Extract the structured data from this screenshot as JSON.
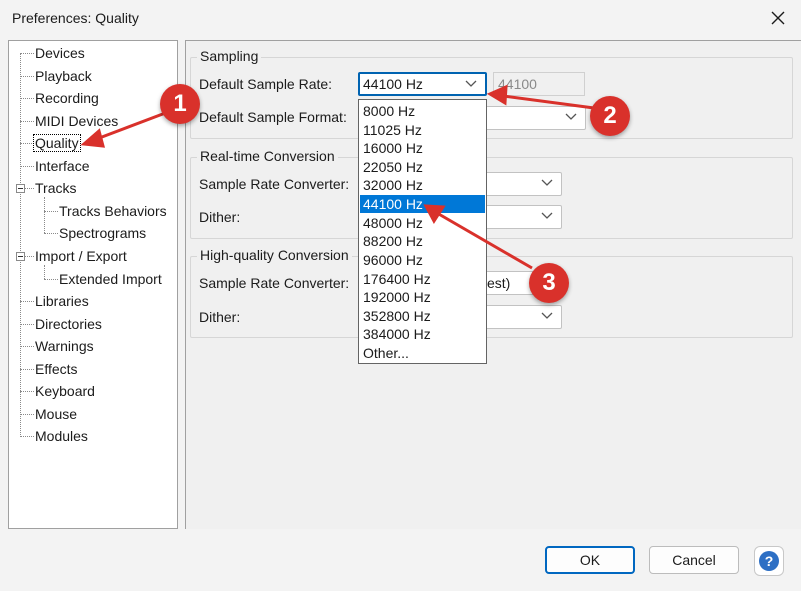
{
  "window": {
    "title": "Preferences: Quality"
  },
  "sidebar": {
    "items": [
      {
        "label": "Devices"
      },
      {
        "label": "Playback"
      },
      {
        "label": "Recording"
      },
      {
        "label": "MIDI Devices"
      },
      {
        "label": "Quality"
      },
      {
        "label": "Interface"
      },
      {
        "label": "Tracks"
      },
      {
        "label": "Tracks Behaviors"
      },
      {
        "label": "Spectrograms"
      },
      {
        "label": "Import / Export"
      },
      {
        "label": "Extended Import"
      },
      {
        "label": "Libraries"
      },
      {
        "label": "Directories"
      },
      {
        "label": "Warnings"
      },
      {
        "label": "Effects"
      },
      {
        "label": "Keyboard"
      },
      {
        "label": "Mouse"
      },
      {
        "label": "Modules"
      }
    ],
    "selected": "Quality"
  },
  "sampling": {
    "group_label": "Sampling",
    "rate_label": "Default Sample Rate:",
    "rate_value": "44100 Hz",
    "rate_custom": "44100",
    "format_label": "Default Sample Format:"
  },
  "realtime": {
    "group_label": "Real-time Conversion",
    "converter_label": "Sample Rate Converter:",
    "dither_label": "Dither:"
  },
  "highquality": {
    "group_label": "High-quality Conversion",
    "converter_label": "Sample Rate Converter:",
    "converter_value_fragment": "est)",
    "dither_label": "Dither:"
  },
  "dropdown": {
    "options": [
      "8000 Hz",
      "11025 Hz",
      "16000 Hz",
      "22050 Hz",
      "32000 Hz",
      "44100 Hz",
      "48000 Hz",
      "88200 Hz",
      "96000 Hz",
      "176400 Hz",
      "192000 Hz",
      "352800 Hz",
      "384000 Hz",
      "Other..."
    ],
    "selected": "44100 Hz"
  },
  "buttons": {
    "ok": "OK",
    "cancel": "Cancel",
    "help": "?"
  },
  "annotations": {
    "badge1": "1",
    "badge2": "2",
    "badge3": "3",
    "color": "#d9312b"
  }
}
